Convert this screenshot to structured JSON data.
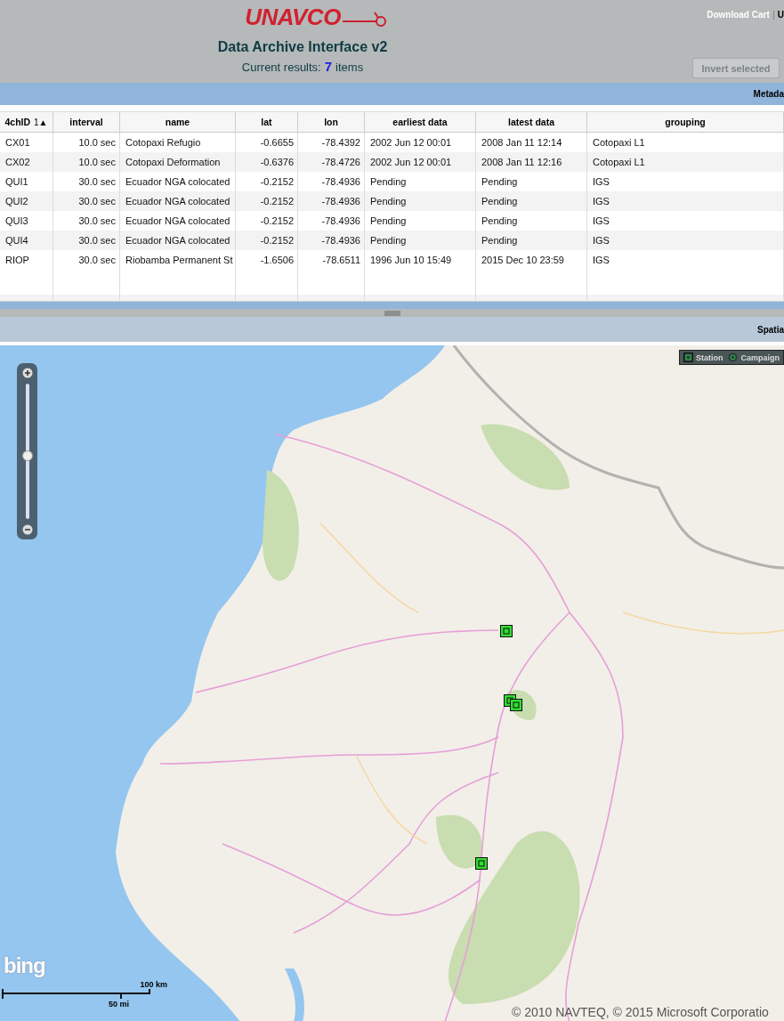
{
  "header": {
    "logo": "UNAVCO",
    "title": "Data Archive Interface v2",
    "results_label": "Current results:",
    "results_count": "7",
    "results_unit": "items",
    "links": [
      "Download Cart",
      "U"
    ],
    "invert_button": {
      "label": "Invert selected",
      "disabled": true
    }
  },
  "metadata_panel": {
    "title": "Metada"
  },
  "table": {
    "columns": [
      {
        "label": "4chID",
        "sort": "1▲"
      },
      {
        "label": "interval"
      },
      {
        "label": "name"
      },
      {
        "label": "lat"
      },
      {
        "label": "lon"
      },
      {
        "label": "earliest data"
      },
      {
        "label": "latest data"
      },
      {
        "label": "grouping"
      }
    ],
    "rows": [
      [
        "CX01",
        "10.0 sec",
        "Cotopaxi Refugio",
        "-0.6655",
        "-78.4392",
        "2002 Jun 12 00:01",
        "2008 Jan 11 12:14",
        "Cotopaxi L1"
      ],
      [
        "CX02",
        "10.0 sec",
        "Cotopaxi Deformation",
        "-0.6376",
        "-78.4726",
        "2002 Jun 12 00:01",
        "2008 Jan 11 12:16",
        "Cotopaxi L1"
      ],
      [
        "QUI1",
        "30.0 sec",
        "Ecuador NGA colocated",
        "-0.2152",
        "-78.4936",
        "Pending",
        "Pending",
        "IGS"
      ],
      [
        "QUI2",
        "30.0 sec",
        "Ecuador NGA colocated",
        "-0.2152",
        "-78.4936",
        "Pending",
        "Pending",
        "IGS"
      ],
      [
        "QUI3",
        "30.0 sec",
        "Ecuador NGA colocated",
        "-0.2152",
        "-78.4936",
        "Pending",
        "Pending",
        "IGS"
      ],
      [
        "QUI4",
        "30.0 sec",
        "Ecuador NGA colocated",
        "-0.2152",
        "-78.4936",
        "Pending",
        "Pending",
        "IGS"
      ],
      [
        "RIOP",
        "30.0 sec",
        "Riobamba Permanent St",
        "-1.6506",
        "-78.6511",
        "1996 Jun 10 15:49",
        "2015 Dec 10 23:59",
        "IGS"
      ]
    ]
  },
  "spatial_panel": {
    "title": "Spatia"
  },
  "map": {
    "legend": [
      {
        "kind": "station",
        "label": "Station"
      },
      {
        "kind": "campaign",
        "label": "Campaign"
      }
    ],
    "markers": [
      {
        "kind": "station"
      },
      {
        "kind": "station"
      },
      {
        "kind": "station"
      },
      {
        "kind": "station"
      }
    ],
    "zoom": {
      "level": 0.47
    },
    "logo": "bing",
    "scale": {
      "metric": "100 km",
      "imperial": "50 mi"
    },
    "copyright": "© 2010 NAVTEQ, © 2015 Microsoft Corporatio"
  }
}
